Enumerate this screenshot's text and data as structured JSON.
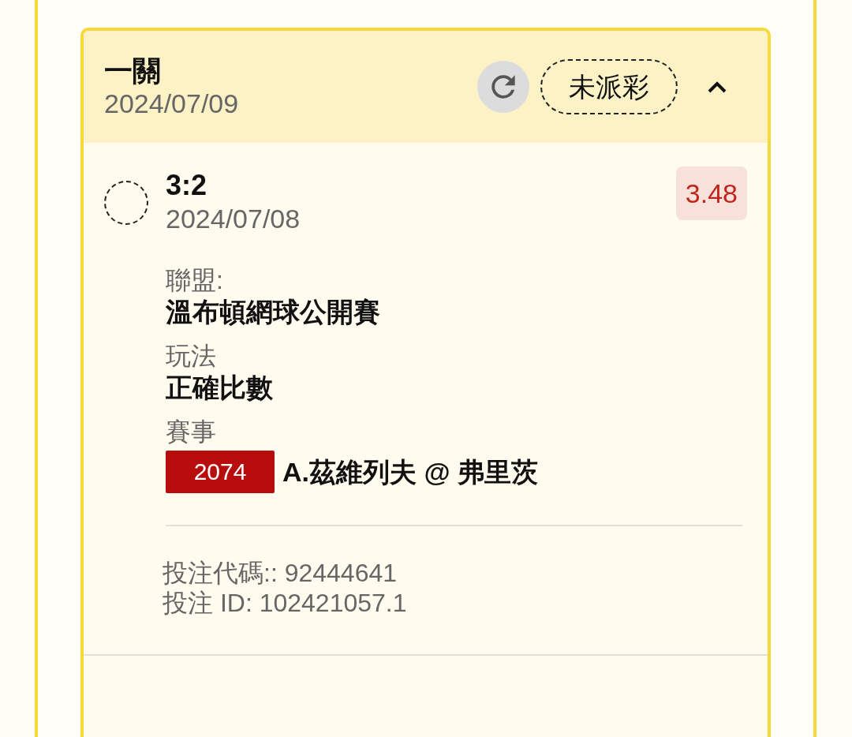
{
  "ticket": {
    "title": "一關",
    "date": "2024/07/09",
    "status": "未派彩",
    "expanded": true
  },
  "legs": [
    {
      "score": "3:2",
      "date": "2024/07/08",
      "odds": "3.48",
      "settled": false,
      "fields": [
        {
          "label": "聯盟:",
          "value": "溫布頓網球公開賽"
        },
        {
          "label": "玩法",
          "value": "正確比數"
        }
      ],
      "event_label": "賽事",
      "match_no": "2074",
      "match": "A.茲維列夫 @ 弗里茨"
    }
  ],
  "footer": [
    "投注代碼:: 92444641",
    "投注 ID: 102421057.1"
  ]
}
